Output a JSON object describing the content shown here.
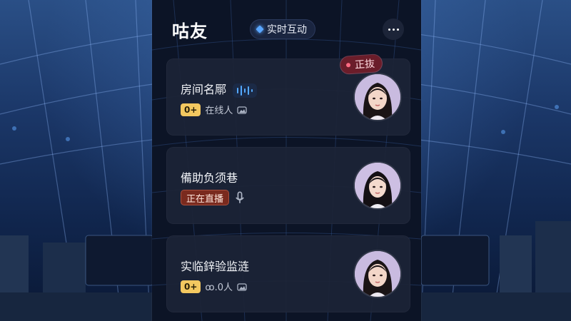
{
  "app": {
    "title": "咕友",
    "live_chip_label": "实时互动"
  },
  "rooms": [
    {
      "title": "房间名鄏",
      "badge": "0+",
      "meta_text": "在线人",
      "status_tag": "正抜",
      "avatar_icon": "avatar-girl"
    },
    {
      "title": "備助负须巷",
      "live_badge": "正在直播",
      "avatar_icon": "avatar-girl"
    },
    {
      "title": "实临鋅验监涟",
      "badge": "0+",
      "meta_text": "ꝏ.0人",
      "avatar_icon": "avatar-girl"
    }
  ],
  "colors": {
    "accent_blue": "#5aa6ff",
    "badge_yellow": "#f3c860",
    "live_red": "#7a2a1e",
    "status_pink": "#6b1d2a"
  }
}
